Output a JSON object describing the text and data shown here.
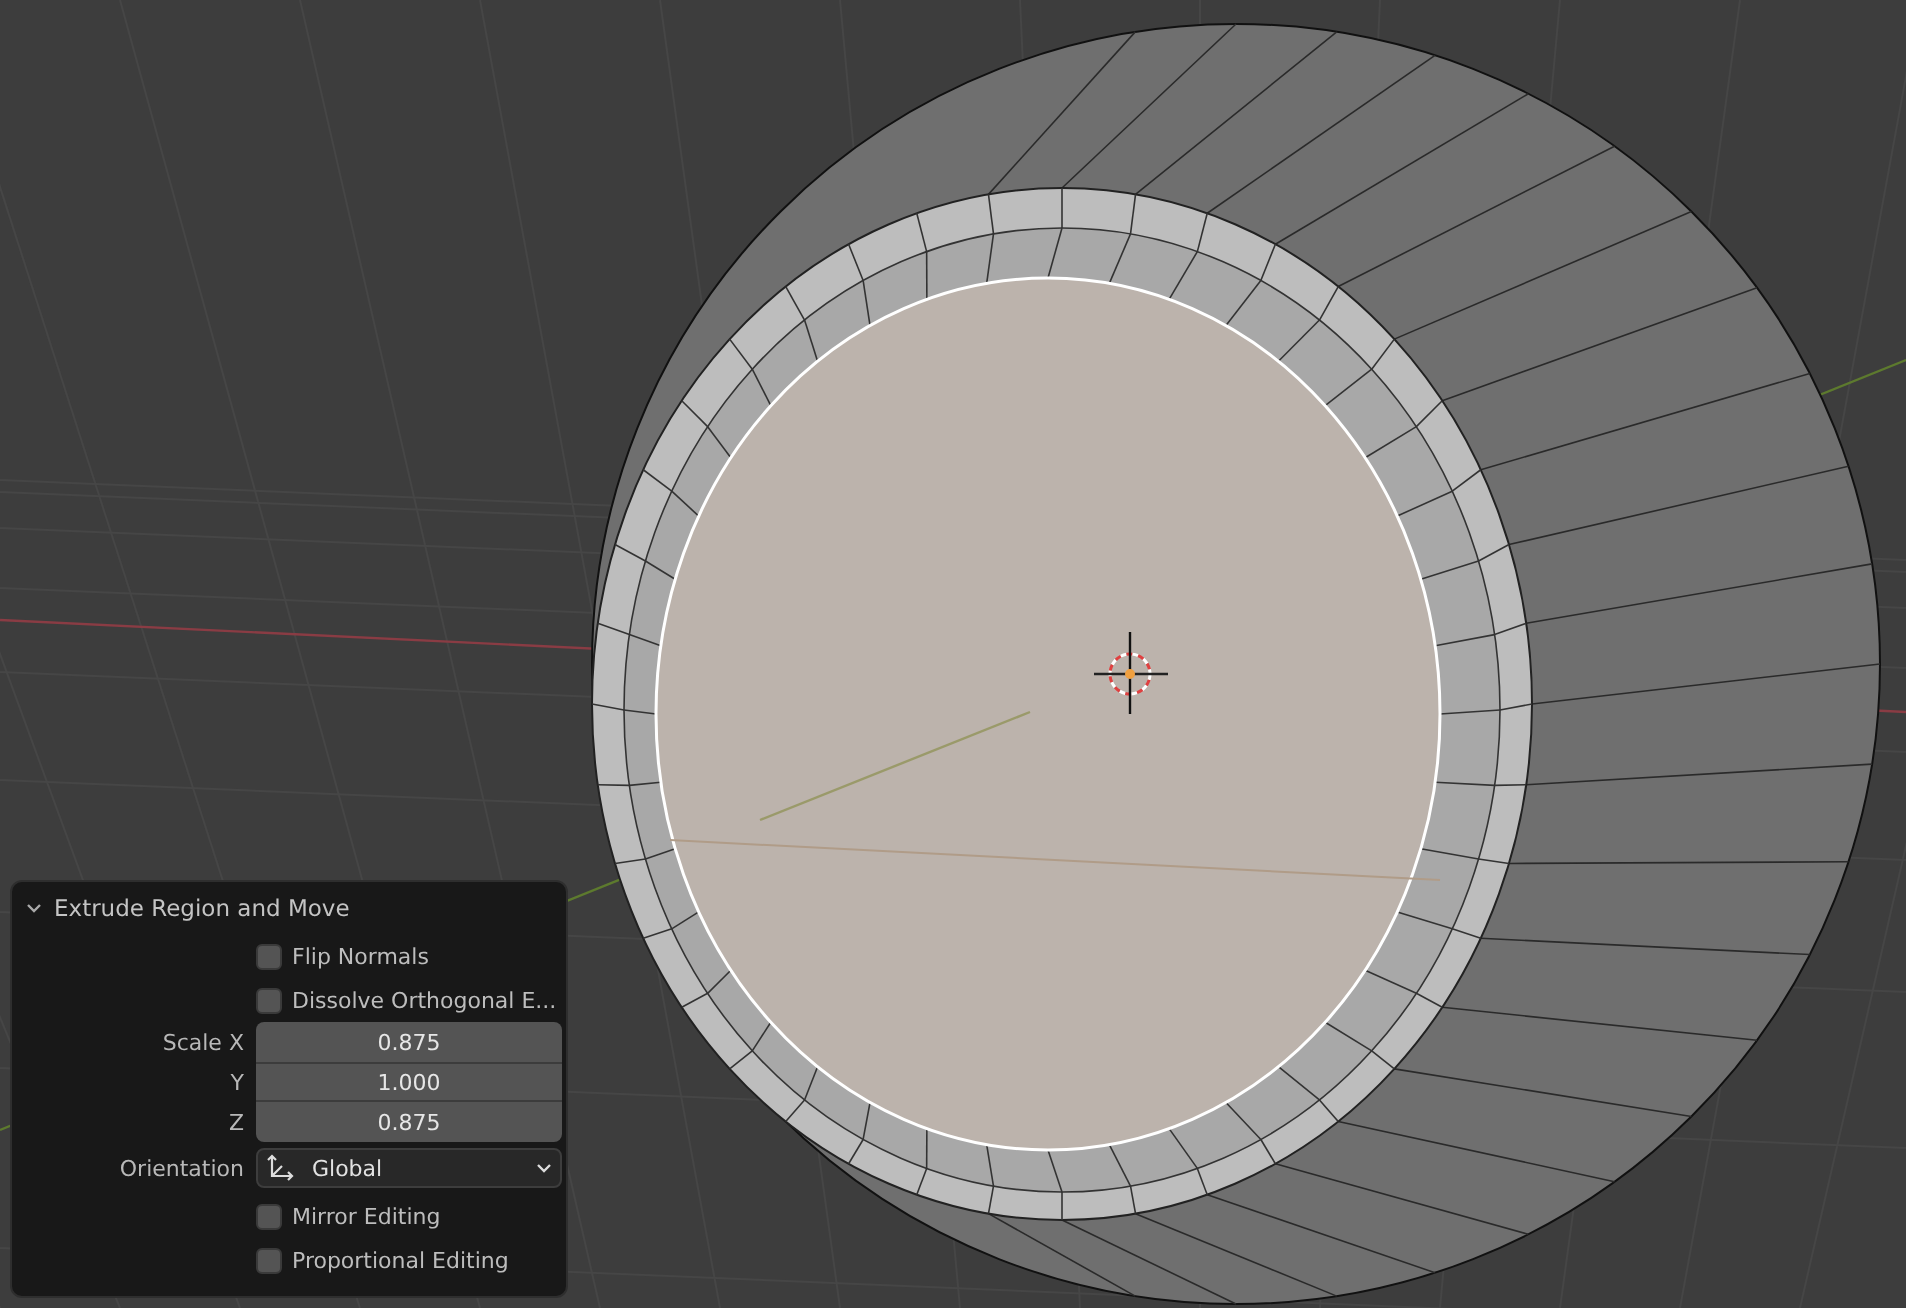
{
  "panel": {
    "title": "Extrude Region and Move",
    "expanded": true,
    "rows": [
      {
        "kind": "checkbox",
        "label": "Flip Normals",
        "checked": false
      },
      {
        "kind": "checkbox",
        "label": "Dissolve Orthogonal E...",
        "checked": false
      },
      {
        "kind": "number",
        "label": "Scale X",
        "value": "0.875"
      },
      {
        "kind": "number",
        "label": "Y",
        "value": "1.000"
      },
      {
        "kind": "number",
        "label": "Z",
        "value": "0.875"
      },
      {
        "kind": "dropdown",
        "label": "Orientation",
        "value": "Global"
      },
      {
        "kind": "checkbox",
        "label": "Mirror Editing",
        "checked": false
      },
      {
        "kind": "checkbox",
        "label": "Proportional Editing",
        "checked": false
      }
    ]
  }
}
